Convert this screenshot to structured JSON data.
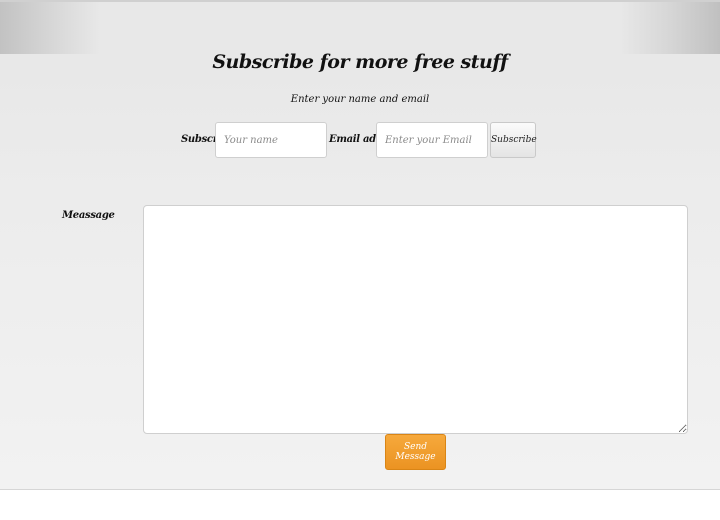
{
  "form": {
    "title": "Subscribe for more free stuff",
    "subtitle": "Enter your name and email",
    "name_label": "Subscribe",
    "name_placeholder": "Your name",
    "email_label": "Email address",
    "email_placeholder": "Enter your Email",
    "subscribe_button": "Subscribe",
    "message_label": "Meassage",
    "send_button": "Send Message"
  },
  "colors": {
    "send_button": "#f0a030",
    "panel_background": "#ececec"
  }
}
